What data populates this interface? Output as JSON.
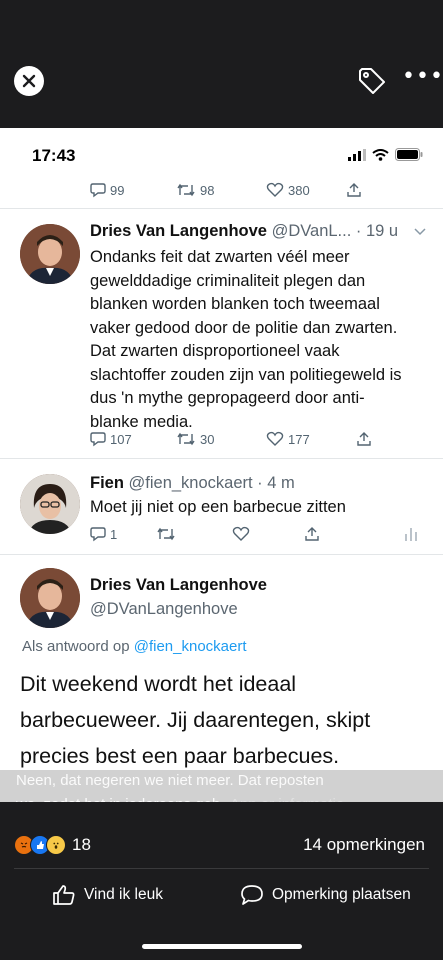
{
  "topbar": {
    "close_icon": "close-icon",
    "tag_icon": "tag-icon",
    "more_label": "•••"
  },
  "status": {
    "time": "17:43"
  },
  "tweet0": {
    "replies": "99",
    "retweets": "98",
    "likes": "380"
  },
  "tweet1": {
    "name": "Dries Van Langenhove",
    "handle": "@DVanL...",
    "time": "· 19 u",
    "lines": [
      "Ondanks feit dat zwarten véél meer",
      "gewelddadige criminaliteit plegen dan",
      "blanken worden blanken toch tweemaal",
      "vaker gedood door de politie dan zwarten.",
      "Dat zwarten disproportioneel vaak",
      "slachtoffer zouden zijn van politiegeweld is",
      "dus 'n mythe gepropageerd door anti-",
      "blanke media."
    ],
    "replies": "107",
    "retweets": "30",
    "likes": "177"
  },
  "tweet2": {
    "name": "Fien",
    "handle": "@fien_knockaert · 4 m",
    "text": "Moet jij niet op een barbecue zitten",
    "replies": "1"
  },
  "tweet3": {
    "name": "Dries Van Langenhove",
    "handle": "@DVanLangenhove",
    "reply_prefix": "Als antwoord op ",
    "reply_mention": "@fien_knockaert",
    "lines": [
      "Dit weekend wordt het ideaal",
      "barbecueweer. Jij daarentegen, skipt",
      "precies best een paar barbecues."
    ]
  },
  "caption": {
    "line1": "Neen, dat negeren we niet meer. Dat reposten",
    "line2": "we, zodat het in iedereens geb",
    "line2_ghost": "App er informatie"
  },
  "footer": {
    "reaction_count": "18",
    "comments": "14 opmerkingen",
    "like_label": "Vind ik leuk",
    "comment_label": "Opmerking plaatsen"
  },
  "colors": {
    "twitter_blue": "#1d9bf0",
    "fb_like_blue": "#1877f2",
    "angry": "#e9710f"
  }
}
